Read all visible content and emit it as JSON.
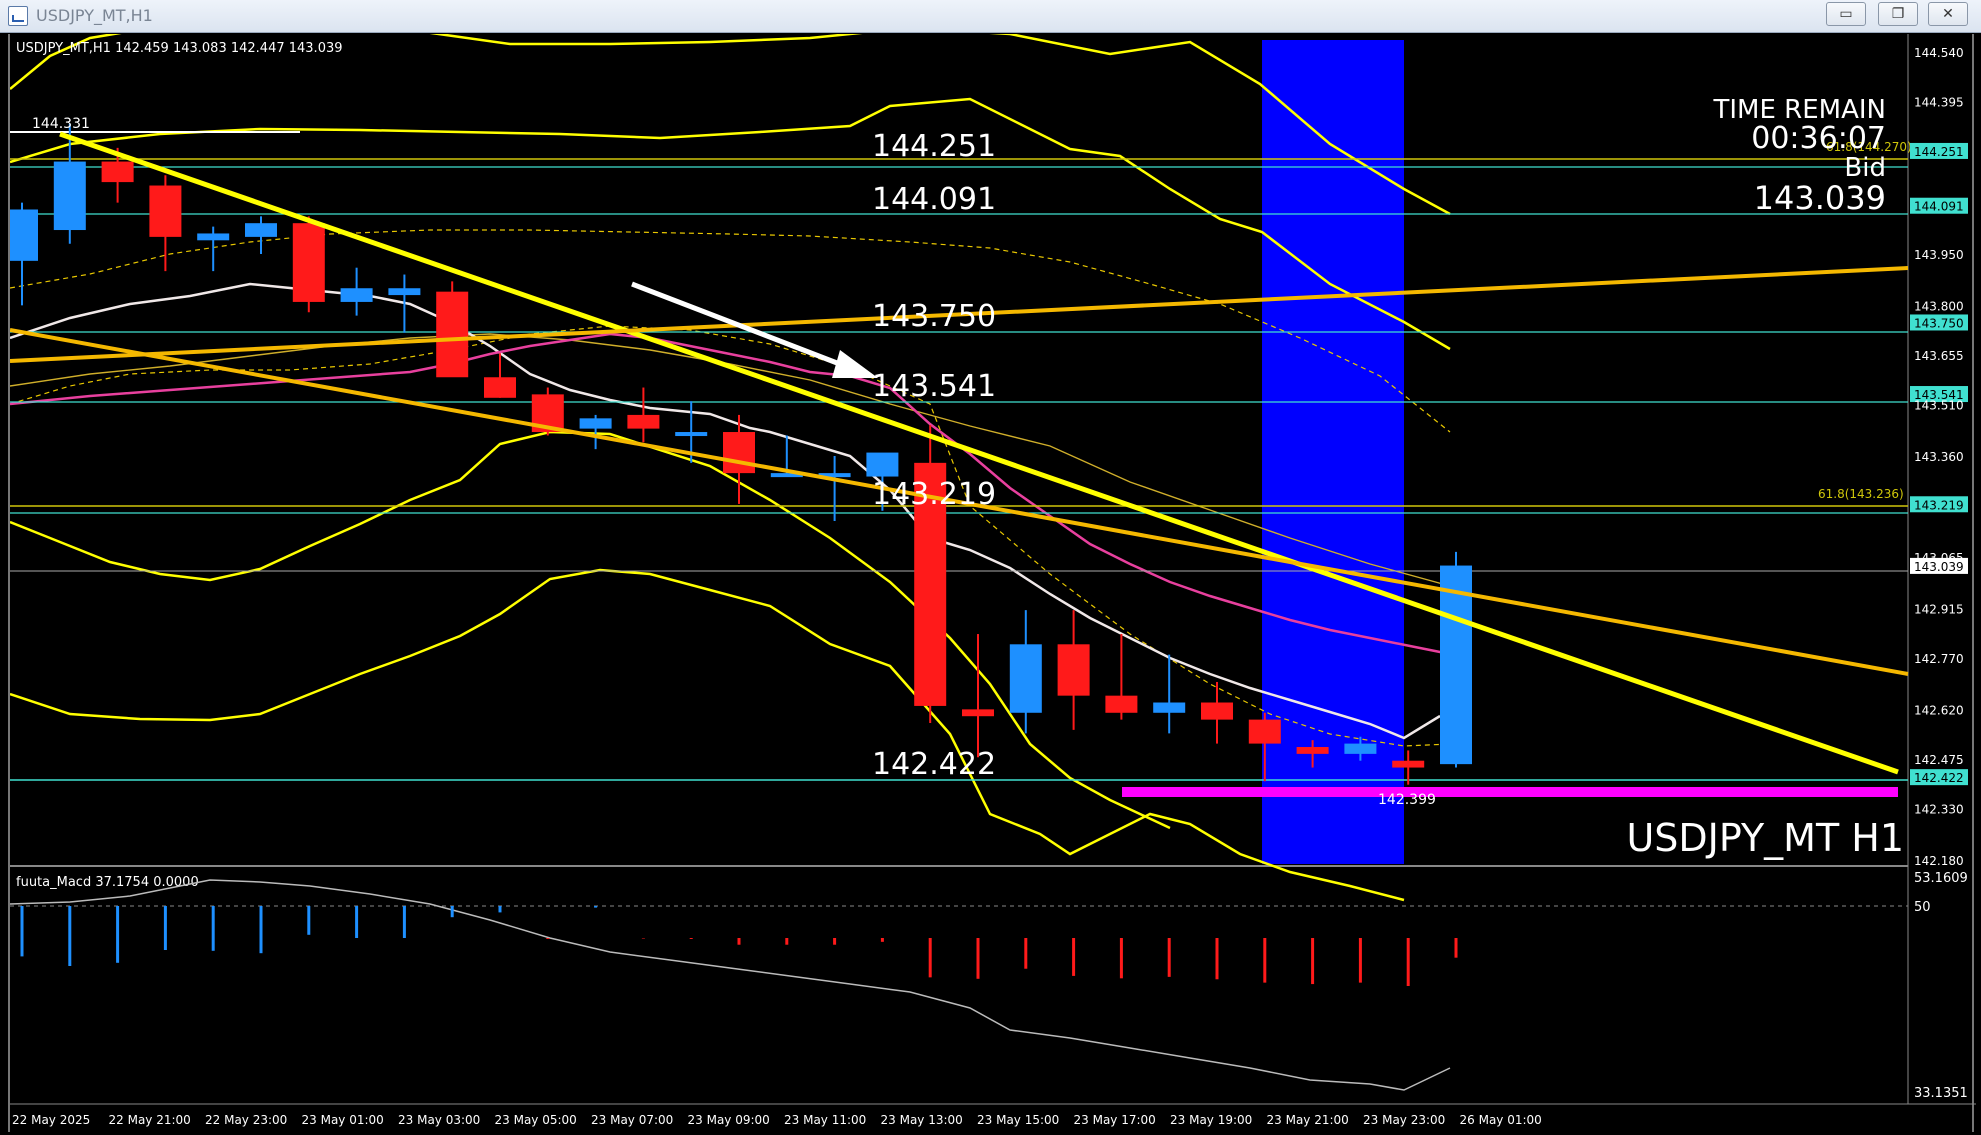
{
  "window": {
    "title": "USDJPY_MT,H1",
    "buttons": {
      "minimize": "▭",
      "restore": "❐",
      "close": "✕"
    }
  },
  "chart_header": {
    "text": "USDJPY_MT,H1  142.459 143.083 142.447 143.039"
  },
  "overlays": {
    "time_remain_label": "TIME REMAIN",
    "time_remain_value": "00:36:07",
    "bid_label": "Bid",
    "bid_value": "143.039",
    "symbol_watermark": "USDJPY_MT H1",
    "fib_label_top": "61.8(144.270)",
    "fib_label_618": "61.8(143.236)"
  },
  "level_labels": {
    "l144251": "144.251",
    "l144091": "144.091",
    "l143750": "143.750",
    "l143541": "143.541",
    "l143219": "143.219",
    "l142422": "142.422",
    "high_marker": "144.331",
    "low_marker": "142.399"
  },
  "colors": {
    "bull": "#1e90ff",
    "bear": "#ff1a1a",
    "trendline": "#ffff00",
    "orange_line": "#f5b800",
    "cyan_level": "#40e0d0",
    "magenta_bar": "#ff00ff",
    "highlight": "#0000ff",
    "price_tag_bg": "#40e0d0"
  },
  "price_axis": {
    "ticks": [
      "144.540",
      "144.395",
      "144.251",
      "144.091",
      "143.950",
      "143.800",
      "143.750",
      "143.655",
      "143.541",
      "143.510",
      "143.360",
      "143.219",
      "143.065",
      "143.039",
      "142.915",
      "142.770",
      "142.620",
      "142.475",
      "142.422",
      "142.330",
      "142.180"
    ],
    "highlighted": [
      "144.251",
      "144.091",
      "143.750",
      "143.541",
      "143.219",
      "143.039",
      "142.422"
    ]
  },
  "time_axis": {
    "ticks": [
      "22 May 2025",
      "22 May 21:00",
      "22 May 23:00",
      "23 May 01:00",
      "23 May 03:00",
      "23 May 05:00",
      "23 May 07:00",
      "23 May 09:00",
      "23 May 11:00",
      "23 May 13:00",
      "23 May 15:00",
      "23 May 17:00",
      "23 May 19:00",
      "23 May 21:00",
      "23 May 23:00",
      "26 May 01:00"
    ]
  },
  "indicator": {
    "header": "fuuta_Macd 37.1754  0.0000",
    "axis_top": "53.1609",
    "axis_mid": "50",
    "axis_bottom": "33.1351"
  },
  "chart_data": {
    "type": "candlestick",
    "symbol": "USDJPY_MT",
    "timeframe": "H1",
    "ylim": [
      142.15,
      144.6
    ],
    "candles": [
      {
        "o": 143.93,
        "h": 144.1,
        "l": 143.8,
        "c": 144.08
      },
      {
        "o": 144.02,
        "h": 144.33,
        "l": 143.98,
        "c": 144.22
      },
      {
        "o": 144.22,
        "h": 144.26,
        "l": 144.1,
        "c": 144.16
      },
      {
        "o": 144.15,
        "h": 144.18,
        "l": 143.9,
        "c": 144.0
      },
      {
        "o": 143.99,
        "h": 144.03,
        "l": 143.9,
        "c": 144.01
      },
      {
        "o": 144.0,
        "h": 144.06,
        "l": 143.95,
        "c": 144.04
      },
      {
        "o": 144.04,
        "h": 144.06,
        "l": 143.78,
        "c": 143.81
      },
      {
        "o": 143.81,
        "h": 143.91,
        "l": 143.77,
        "c": 143.85
      },
      {
        "o": 143.83,
        "h": 143.89,
        "l": 143.72,
        "c": 143.85
      },
      {
        "o": 143.84,
        "h": 143.87,
        "l": 143.6,
        "c": 143.59
      },
      {
        "o": 143.59,
        "h": 143.66,
        "l": 143.53,
        "c": 143.53
      },
      {
        "o": 143.54,
        "h": 143.56,
        "l": 143.42,
        "c": 143.43
      },
      {
        "o": 143.44,
        "h": 143.48,
        "l": 143.38,
        "c": 143.47
      },
      {
        "o": 143.48,
        "h": 143.56,
        "l": 143.4,
        "c": 143.44
      },
      {
        "o": 143.43,
        "h": 143.52,
        "l": 143.34,
        "c": 143.43
      },
      {
        "o": 143.43,
        "h": 143.48,
        "l": 143.22,
        "c": 143.31
      },
      {
        "o": 143.31,
        "h": 143.42,
        "l": 143.3,
        "c": 143.31
      },
      {
        "o": 143.31,
        "h": 143.36,
        "l": 143.17,
        "c": 143.31
      },
      {
        "o": 143.3,
        "h": 143.32,
        "l": 143.2,
        "c": 143.37
      },
      {
        "o": 143.34,
        "h": 143.45,
        "l": 142.58,
        "c": 142.63
      },
      {
        "o": 142.62,
        "h": 142.84,
        "l": 142.48,
        "c": 142.6
      },
      {
        "o": 142.61,
        "h": 142.91,
        "l": 142.55,
        "c": 142.81
      },
      {
        "o": 142.81,
        "h": 142.91,
        "l": 142.56,
        "c": 142.66
      },
      {
        "o": 142.66,
        "h": 142.84,
        "l": 142.59,
        "c": 142.61
      },
      {
        "o": 142.61,
        "h": 142.78,
        "l": 142.55,
        "c": 142.64
      },
      {
        "o": 142.64,
        "h": 142.7,
        "l": 142.52,
        "c": 142.59
      },
      {
        "o": 142.59,
        "h": 142.61,
        "l": 142.41,
        "c": 142.52
      },
      {
        "o": 142.51,
        "h": 142.53,
        "l": 142.45,
        "c": 142.49
      },
      {
        "o": 142.49,
        "h": 142.54,
        "l": 142.47,
        "c": 142.52
      },
      {
        "o": 142.47,
        "h": 142.5,
        "l": 142.4,
        "c": 142.45
      },
      {
        "o": 142.46,
        "h": 143.08,
        "l": 142.45,
        "c": 143.04
      }
    ]
  }
}
